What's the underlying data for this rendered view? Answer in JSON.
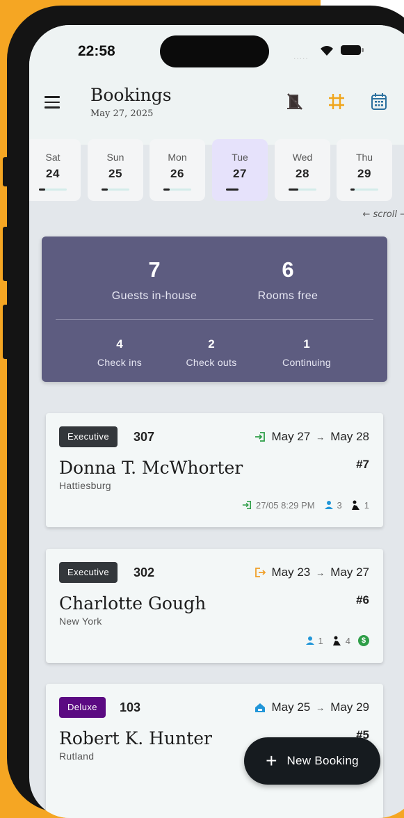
{
  "status_bar": {
    "time": "22:58",
    "signal": "....."
  },
  "header": {
    "title": "Bookings",
    "subtitle": "May 27, 2025"
  },
  "icons": {
    "menu": "menu-icon",
    "room_unavailable": "door-closed-icon",
    "grid": "grid-icon",
    "calendar": "calendar-icon"
  },
  "colors": {
    "accent_orange": "#f0a51b",
    "calendar_blue": "#2a6f9e",
    "summary_bg": "#5d5c80",
    "executive_badge": "#33373b",
    "deluxe_badge": "#5b0a82",
    "checkin_green": "#2e9e48",
    "checkout_orange": "#f0a02a",
    "guest_blue": "#2196d8"
  },
  "days": [
    {
      "name": "Sat",
      "date": "24"
    },
    {
      "name": "Sun",
      "date": "25"
    },
    {
      "name": "Mon",
      "date": "26"
    },
    {
      "name": "Tue",
      "date": "27",
      "selected": true
    },
    {
      "name": "Wed",
      "date": "28"
    },
    {
      "name": "Thu",
      "date": "29"
    }
  ],
  "scroll_hint": "← scroll →",
  "summary": {
    "guests_in_house": {
      "value": "7",
      "label": "Guests in-house"
    },
    "rooms_free": {
      "value": "6",
      "label": "Rooms free"
    },
    "check_ins": {
      "value": "4",
      "label": "Check ins"
    },
    "check_outs": {
      "value": "2",
      "label": "Check outs"
    },
    "continuing": {
      "value": "1",
      "label": "Continuing"
    }
  },
  "bookings": [
    {
      "room_type": "Executive",
      "room": "307",
      "status_icon": "check-in-icon",
      "from": "May 27",
      "to": "May 28",
      "arrow": "→",
      "guest": "Donna T. McWhorter",
      "city": "Hattiesburg",
      "number": "#7",
      "checked_in_at": "27/05 8:29 PM",
      "guests": "3",
      "nights": "1"
    },
    {
      "room_type": "Executive",
      "room": "302",
      "status_icon": "check-out-icon",
      "from": "May 23",
      "to": "May 27",
      "arrow": "→",
      "guest": "Charlotte Gough",
      "city": "New York",
      "number": "#6",
      "guests": "1",
      "nights": "4",
      "payment": "$"
    },
    {
      "room_type": "Deluxe",
      "room": "103",
      "status_icon": "home-icon",
      "from": "May 25",
      "to": "May 29",
      "arrow": "→",
      "guest": "Robert K. Hunter",
      "city": "Rutland",
      "number": "#5"
    }
  ],
  "fab": {
    "label": "New Booking",
    "plus": "+"
  }
}
